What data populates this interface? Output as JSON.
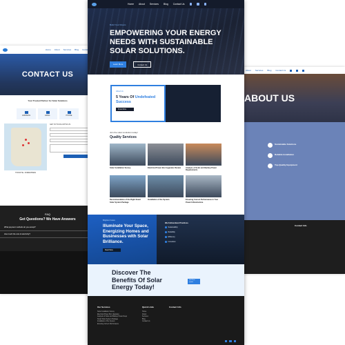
{
  "contact_page": {
    "nav": [
      "Home",
      "About",
      "Services",
      "Blog",
      "Contact Us"
    ],
    "hero_title": "CONTACT US",
    "intro_heading": "Your Trusted Partner for Solar Solutions",
    "cards": [
      {
        "label": "ADDRESS",
        "icon": "location-icon"
      },
      {
        "label": "EMAIL",
        "icon": "mail-icon"
      },
      {
        "label": "PHONE",
        "icon": "phone-icon"
      }
    ],
    "map_label": "TOOCITE • FORESTDEN",
    "form_heading": "GET IN TOUCH WITH US",
    "form_button": "Submit",
    "faq_small": "FAQ",
    "faq_heading": "Get Questions? We Have Answers",
    "faq_questions": [
      "What payment methods do you accept?",
      "How much the cost of electricity?"
    ]
  },
  "home_page": {
    "nav": [
      "Home",
      "About",
      "Services",
      "Blog",
      "Contact Us"
    ],
    "hero": {
      "kicker": "Build Your Dream",
      "title": "EMPOWERING YOUR ENERGY NEEDS WITH SUSTAINABLE SOLAR SOLUTIONS.",
      "button_primary": "Learn More",
      "button_secondary": "Contact Us"
    },
    "experience": {
      "kicker": "About Us",
      "title_prefix": "5 Years Of",
      "title_accent": "Undefeated Success",
      "button": "Know More"
    },
    "services": {
      "kicker": "Join the solar revolution today!",
      "heading": "Quality Services",
      "items": [
        {
          "caption": "Solar Installation Survey",
          "color": "#9fb6c8"
        },
        {
          "caption": "Electrical Power Box Upgrades Review",
          "color": "#8c8f96"
        },
        {
          "caption": "Analysis of Solar and Backup Power Requirements",
          "color": "#c98a5a"
        },
        {
          "caption": "Recommendation of the Right Smart Solar System Package",
          "color": "#7ea4c7"
        },
        {
          "caption": "Installation of the System",
          "color": "#6e8ea9"
        },
        {
          "caption": "Ensuring Correct Performance in Your Power Infrastructure",
          "color": "#aab8c6"
        }
      ]
    },
    "illuminate": {
      "kicker": "Brighten Future",
      "title": "Illuminate Your Space, Energizing Homes and Businesses with Solar Brilliance.",
      "button": "Read More",
      "right_heading": "We Follow Best Practices",
      "right_items": [
        "Sustainability",
        "Reliability",
        "Efficiency",
        "Innovation"
      ]
    },
    "discover": {
      "title": "Discover The Benefits Of Solar Energy Today!",
      "button": "Get Free Quote"
    },
    "footer": {
      "col1_title": "Our Services",
      "col1_items": [
        "Solar Installation Survey",
        "Electrical Power Box Upgrades",
        "Analysis of Solar and Backup Power Reqs",
        "Smart Solar System Package",
        "Installation of the System",
        "Ensuring Correct Performance"
      ],
      "col2_title": "Quick Links",
      "col2_items": [
        "Home",
        "About",
        "Services",
        "Blog",
        "Contact Us"
      ],
      "col3_title": "Contact Info"
    }
  },
  "about_page": {
    "nav": [
      "About",
      "Services",
      "Blog",
      "Contact Us"
    ],
    "hero_title": "ABOUT US",
    "features": [
      {
        "title": "Sustainable Solutions"
      },
      {
        "title": "Reliable Installation"
      },
      {
        "title": "Top-Quality Equipment"
      }
    ],
    "footer_title": "Contact Info"
  },
  "colors": {
    "accent": "#2f7fe0",
    "dark": "#141b2b",
    "footer": "#1a1a1a"
  }
}
